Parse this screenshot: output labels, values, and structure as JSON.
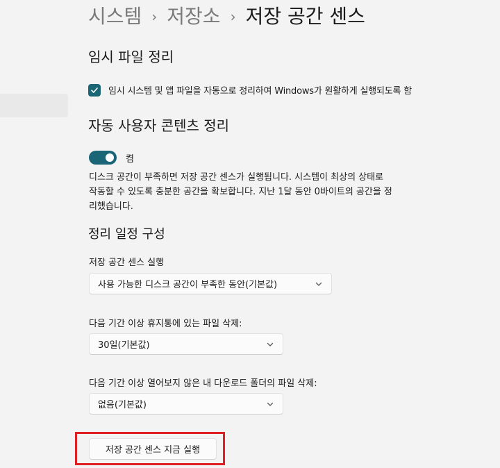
{
  "breadcrumb": {
    "items": [
      "시스템",
      "저장소",
      "저장 공간 센스"
    ],
    "separator": "›"
  },
  "temp_files": {
    "title": "임시 파일 정리",
    "checkbox_label": "임시 시스템 및 앱 파일을 자동으로 정리하여 Windows가 원활하게 실행되도록 함",
    "checked": true
  },
  "auto_cleanup": {
    "title": "자동 사용자 콘텐츠 정리",
    "toggle_label": "켬",
    "toggle_on": true,
    "description": "디스크 공간이 부족하면 저장 공간 센스가 실행됩니다. 시스템이 최상의 상태로 작동할 수 있도록 충분한 공간을 확보합니다. 지난 1달 동안 0바이트의 공간을 정리했습니다."
  },
  "schedule": {
    "title": "정리 일정 구성",
    "run_label": "저장 공간 센스 실행",
    "run_value": "사용 가능한 디스크 공간이 부족한 동안(기본값)",
    "recycle_label": "다음 기간 이상 휴지통에 있는 파일 삭제:",
    "recycle_value": "30일(기본값)",
    "downloads_label": "다음 기간 이상 열어보지 않은 내 다운로드 폴더의 파일 삭제:",
    "downloads_value": "없음(기본값)"
  },
  "run_now_button": "저장 공간 센스 지금 실행",
  "colors": {
    "accent": "#1a6576",
    "highlight": "#e01f24",
    "background": "#f3f3f3"
  },
  "icons": {
    "checkbox": "checkmark-icon",
    "dropdown": "chevron-down-icon"
  }
}
